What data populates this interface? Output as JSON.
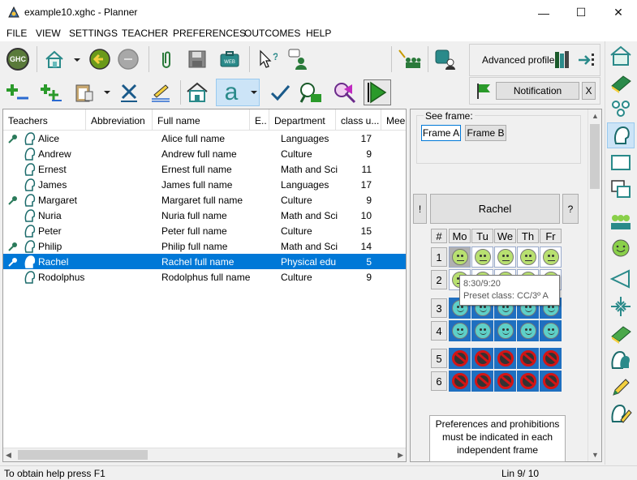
{
  "window": {
    "title": "example10.xghc - Planner",
    "minimize": "—",
    "maximize": "☐",
    "close": "✕"
  },
  "menu": [
    "FILE",
    "VIEW",
    "SETTINGS",
    "TEACHER",
    "PREFERENCES",
    "OUTCOMES",
    "HELP"
  ],
  "toolbar": {
    "ghc_label": "GHC",
    "font_label": "a",
    "advanced_profile": "Advanced profile",
    "notification": "Notification",
    "notification_close": "X"
  },
  "list": {
    "columns": [
      "Teachers",
      "Abbreviation",
      "Full name",
      "E..",
      "Department",
      "class u...",
      "Mee"
    ],
    "rows": [
      {
        "name": "Alice",
        "full": "Alice full name",
        "dept": "Languages",
        "classes": "17",
        "flag": true
      },
      {
        "name": "Andrew",
        "full": "Andrew full name",
        "dept": "Culture",
        "classes": "9",
        "flag": false
      },
      {
        "name": "Ernest",
        "full": "Ernest full name",
        "dept": "Math and Sci",
        "classes": "11",
        "flag": false
      },
      {
        "name": "James",
        "full": "James full name",
        "dept": "Languages",
        "classes": "17",
        "flag": false
      },
      {
        "name": "Margaret",
        "full": "Margaret full name",
        "dept": "Culture",
        "classes": "9",
        "flag": true
      },
      {
        "name": "Nuria",
        "full": "Nuria full name",
        "dept": "Math and Sci",
        "classes": "10",
        "flag": false
      },
      {
        "name": "Peter",
        "full": "Peter full name",
        "dept": "Culture",
        "classes": "15",
        "flag": false
      },
      {
        "name": "Philip",
        "full": "Philip full name",
        "dept": "Math and Sci",
        "classes": "14",
        "flag": true
      },
      {
        "name": "Rachel",
        "full": "Rachel full name",
        "dept": "Physical edu",
        "classes": "5",
        "flag": true,
        "selected": true
      },
      {
        "name": "Rodolphus",
        "full": "Rodolphus full name",
        "dept": "Culture",
        "classes": "9",
        "flag": false
      }
    ]
  },
  "frame": {
    "see_frame": "See frame:",
    "frame_a": "Frame A",
    "frame_b": "Frame B",
    "exclaim": "!",
    "teacher": "Rachel",
    "question": "?",
    "hash": "#",
    "days": [
      "Mo",
      "Tu",
      "We",
      "Th",
      "Fr"
    ],
    "periods": [
      "1",
      "2",
      "3",
      "4",
      "5",
      "6"
    ],
    "tooltip_time": "8:30/9:20",
    "tooltip_preset": "Preset class: CC/3º A",
    "note": "Preferences and prohibitions must be indicated in each independent frame"
  },
  "status": {
    "help": "To obtain help press F1",
    "line": "Lin 9/ 10"
  },
  "colors": {
    "selection": "#0078d7",
    "teal": "#2a8a8a",
    "smile": "#b8e070",
    "smile_blue": "#5ed0c8"
  }
}
